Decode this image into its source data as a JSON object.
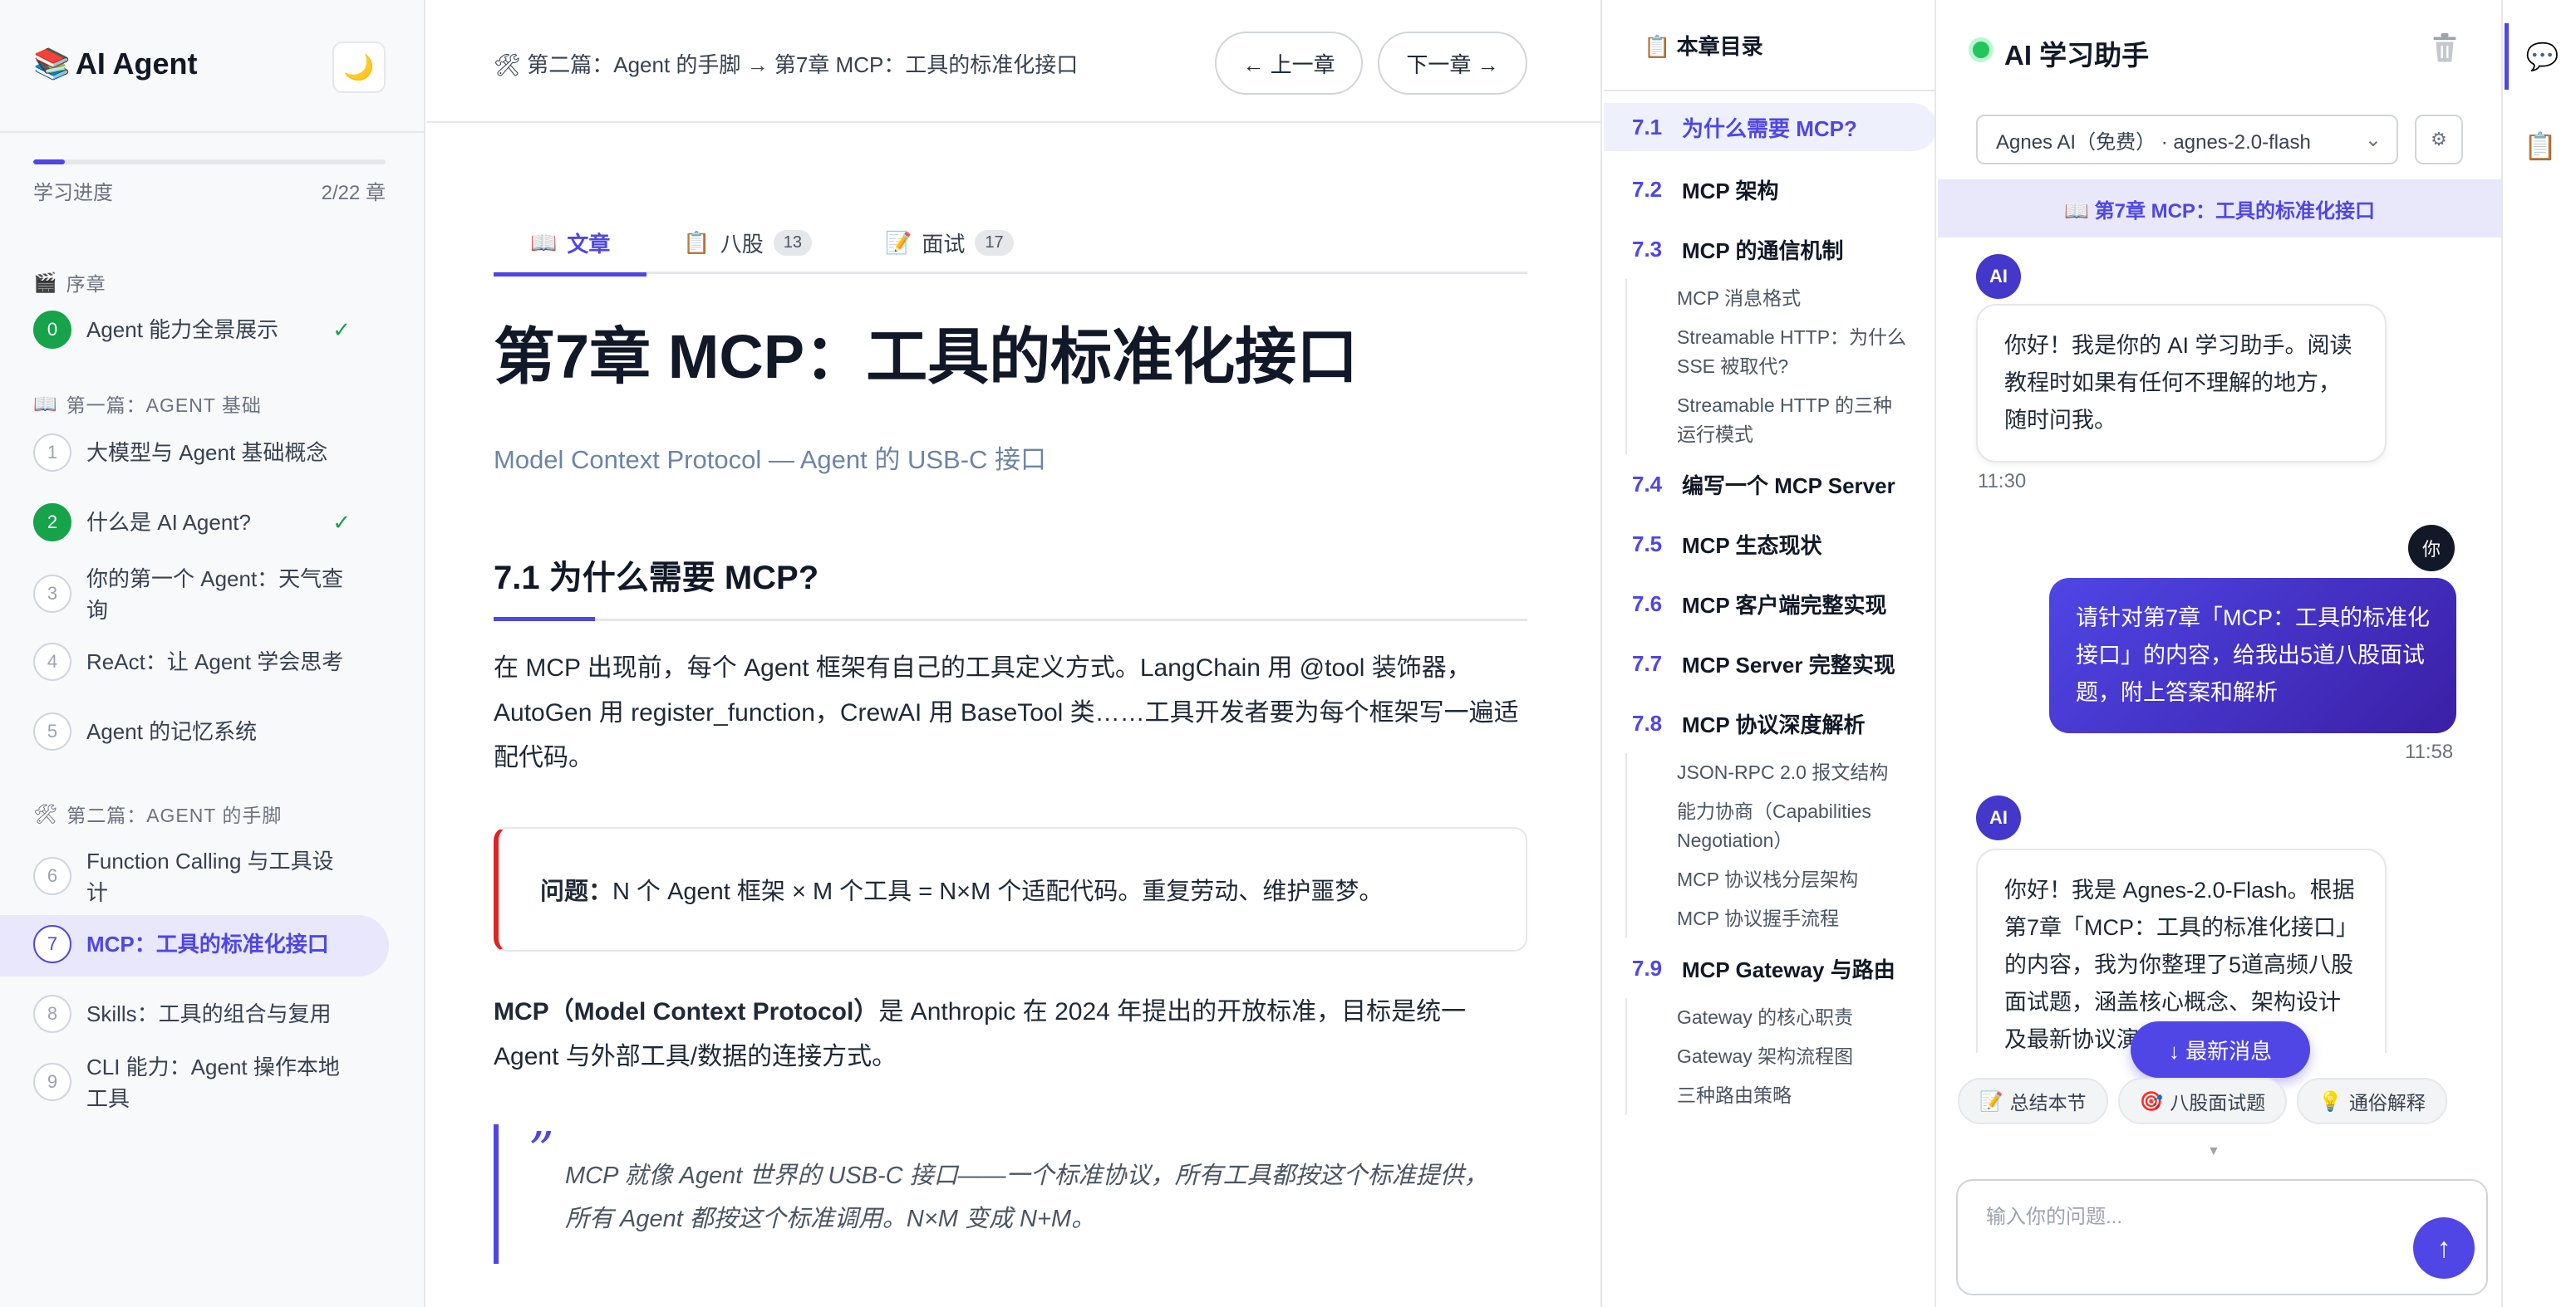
{
  "sidebar": {
    "brand_logo": "📚",
    "brand": "AI Agent",
    "theme_icon": "🌙",
    "progress": {
      "label": "学习进度",
      "value_text": "2/22 章",
      "fraction": 0.09
    },
    "sections": [
      {
        "icon": "🎬",
        "title": "序章",
        "items": [
          {
            "num": "0",
            "label": "Agent 能力全景展示",
            "status": "done"
          }
        ]
      },
      {
        "icon": "📖",
        "title": "第一篇：AGENT 基础",
        "items": [
          {
            "num": "1",
            "label": "大模型与 Agent 基础概念",
            "status": "todo"
          },
          {
            "num": "2",
            "label": "什么是 AI Agent?",
            "status": "done"
          },
          {
            "num": "3",
            "label": "你的第一个 Agent：天气查询",
            "status": "todo"
          },
          {
            "num": "4",
            "label": "ReAct：让 Agent 学会思考",
            "status": "todo"
          },
          {
            "num": "5",
            "label": "Agent 的记忆系统",
            "status": "todo"
          }
        ]
      },
      {
        "icon": "🛠",
        "title": "第二篇：AGENT 的手脚",
        "items": [
          {
            "num": "6",
            "label": "Function Calling 与工具设计",
            "status": "todo"
          },
          {
            "num": "7",
            "label": "MCP：工具的标准化接口",
            "status": "active"
          },
          {
            "num": "8",
            "label": "Skills：工具的组合与复用",
            "status": "todo"
          },
          {
            "num": "9",
            "label": "CLI 能力：Agent 操作本地工具",
            "status": "todo"
          }
        ]
      }
    ],
    "check_mark": "✓"
  },
  "main": {
    "breadcrumb": "🛠 第二篇：Agent 的手脚 → 第7章 MCP：工具的标准化接口",
    "prev_label": "← 上一章",
    "next_label": "下一章 →",
    "tabs": [
      {
        "icon": "📖",
        "label": "文章",
        "badge": ""
      },
      {
        "icon": "📋",
        "label": "八股",
        "badge": "13"
      },
      {
        "icon": "📝",
        "label": "面试",
        "badge": "17"
      }
    ],
    "title": "第7章 MCP：工具的标准化接口",
    "subtitle": "Model Context Protocol — Agent 的 USB-C 接口",
    "section_heading": "7.1 为什么需要 MCP?",
    "para1": "在 MCP 出现前，每个 Agent 框架有自己的工具定义方式。LangChain 用 @tool 装饰器，AutoGen 用 register_function，CrewAI 用 BaseTool 类……工具开发者要为每个框架写一遍适配代码。",
    "callout_label": "问题：",
    "callout_text": "N 个 Agent 框架 × M 个工具 = N×M 个适配代码。重复劳动、维护噩梦。",
    "para2_bold": "MCP（Model Context Protocol）",
    "para2_text": "是 Anthropic 在 2024 年提出的开放标准，目标是统一 Agent 与外部工具/数据的连接方式。",
    "quote_mark": "”",
    "quote": "MCP 就像 Agent 世界的 USB-C 接口——一个标准协议，所有工具都按这个标准提供，所有 Agent 都按这个标准调用。N×M 变成 N+M。"
  },
  "toc": {
    "title": "📋 本章目录",
    "items": [
      {
        "num": "7.1",
        "label": "为什么需要 MCP?",
        "active": true,
        "subs": []
      },
      {
        "num": "7.2",
        "label": "MCP 架构",
        "subs": []
      },
      {
        "num": "7.3",
        "label": "MCP 的通信机制",
        "subs": [
          "MCP 消息格式",
          "Streamable HTTP：为什么 SSE 被取代?",
          "Streamable HTTP 的三种运行模式"
        ]
      },
      {
        "num": "7.4",
        "label": "编写一个 MCP Server",
        "subs": []
      },
      {
        "num": "7.5",
        "label": "MCP 生态现状",
        "subs": []
      },
      {
        "num": "7.6",
        "label": "MCP 客户端完整实现",
        "subs": []
      },
      {
        "num": "7.7",
        "label": "MCP Server 完整实现",
        "subs": []
      },
      {
        "num": "7.8",
        "label": "MCP 协议深度解析",
        "subs": [
          "JSON-RPC 2.0 报文结构",
          "能力协商（Capabilities Negotiation）",
          "MCP 协议栈分层架构",
          "MCP 协议握手流程"
        ]
      },
      {
        "num": "7.9",
        "label": "MCP Gateway 与路由",
        "subs": [
          "Gateway 的核心职责",
          "Gateway 架构流程图",
          "三种路由策略"
        ]
      }
    ]
  },
  "chat": {
    "title": "AI 学习助手",
    "model_selected": "Agnes AI（免费） · agnes-2.0-flash",
    "context": "📖 第7章 MCP：工具的标准化接口",
    "ai_avatar": "AI",
    "user_avatar": "你",
    "messages": [
      {
        "role": "ai",
        "text": "你好！我是你的 AI 学习助手。阅读教程时如果有任何不理解的地方，随时问我。",
        "time": "11:30"
      },
      {
        "role": "user",
        "text": "请针对第7章「MCP：工具的标准化接口」的内容，给我出5道八股面试题，附上答案和解析",
        "time": "11:58"
      },
      {
        "role": "ai",
        "text": "你好！我是 Agnes-2.0-Flash。根据第7章「MCP：工具的标准化接口」的内容，我为你整理了5道高频八股面试题，涵盖核心概念、架构设计及最新协议演进",
        "time": ""
      }
    ],
    "new_msg": "↓ 最新消息",
    "quick_actions": [
      {
        "icon": "📝",
        "label": "总结本节"
      },
      {
        "icon": "🎯",
        "label": "八股面试题"
      },
      {
        "icon": "💡",
        "label": "通俗解释"
      }
    ],
    "input_placeholder": "输入你的问题...",
    "send_icon": "↑"
  },
  "rail": {
    "chat_icon": "💬",
    "notes_icon": "📋"
  }
}
